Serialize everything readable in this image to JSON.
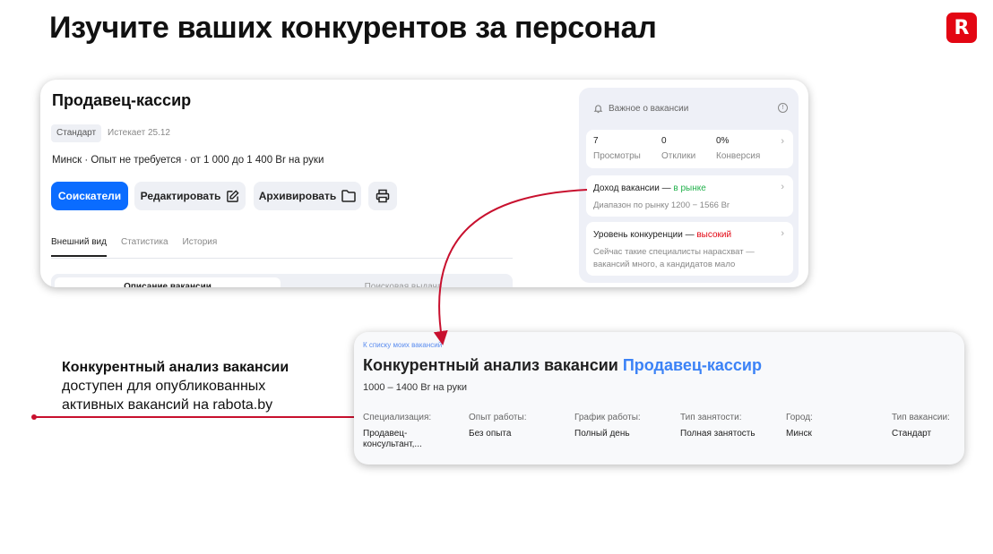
{
  "slide": {
    "title": "Изучите ваших конкурентов за персонал",
    "logo_letter": "R",
    "brand_color": "#e30613"
  },
  "vacancy_card": {
    "title": "Продавец-кассир",
    "tag": "Стандарт",
    "expires": "Истекает 25.12",
    "meta": "Минск  ·  Опыт не требуется  ·  от 1 000 до 1 400 Br на руки",
    "buttons": {
      "applicants": "Соискатели",
      "edit": "Редактировать",
      "archive": "Архивировать",
      "edit_icon": "edit-icon",
      "archive_icon": "folder-icon",
      "print_icon": "printer-icon"
    },
    "tabs": [
      "Внешний вид",
      "Статистика",
      "История"
    ],
    "segments": [
      "Описание вакансии",
      "Поисковая выдача"
    ],
    "sidebar": {
      "header": "Важное о вакансии",
      "stats": [
        {
          "value": "7",
          "label": "Просмотры"
        },
        {
          "value": "0",
          "label": "Отклики"
        },
        {
          "value": "0%",
          "label": "Конверсия"
        }
      ],
      "income": {
        "title": "Доход вакансии — ",
        "status": "в рынке",
        "subtitle": "Диапазон по рынку 1200 − 1566 Br"
      },
      "competition": {
        "title": "Уровень конкуренции — ",
        "status": "высокий",
        "subtitle": "Сейчас такие специалисты нарасхват — вакансий много, а кандидатов мало"
      }
    }
  },
  "annotation": {
    "bold": "Конкурентный анализ вакансии",
    "line2": "доступен для опубликованных",
    "line3": "активных вакансий на rabota.by"
  },
  "analysis_card": {
    "back_link": "К списку моих вакансий",
    "title_prefix": "Конкурентный анализ вакансии ",
    "title_highlight": "Продавец-кассир",
    "salary": "1000 – 1400 Br на руки",
    "columns": [
      {
        "header": "Специализация:",
        "value": "Продавец-консультант,..."
      },
      {
        "header": "Опыт работы:",
        "value": "Без опыта"
      },
      {
        "header": "График работы:",
        "value": "Полный день"
      },
      {
        "header": "Тип занятости:",
        "value": "Полная занятость"
      },
      {
        "header": "Город:",
        "value": "Минск"
      },
      {
        "header": "Тип вакансии:",
        "value": "Стандарт"
      }
    ]
  }
}
